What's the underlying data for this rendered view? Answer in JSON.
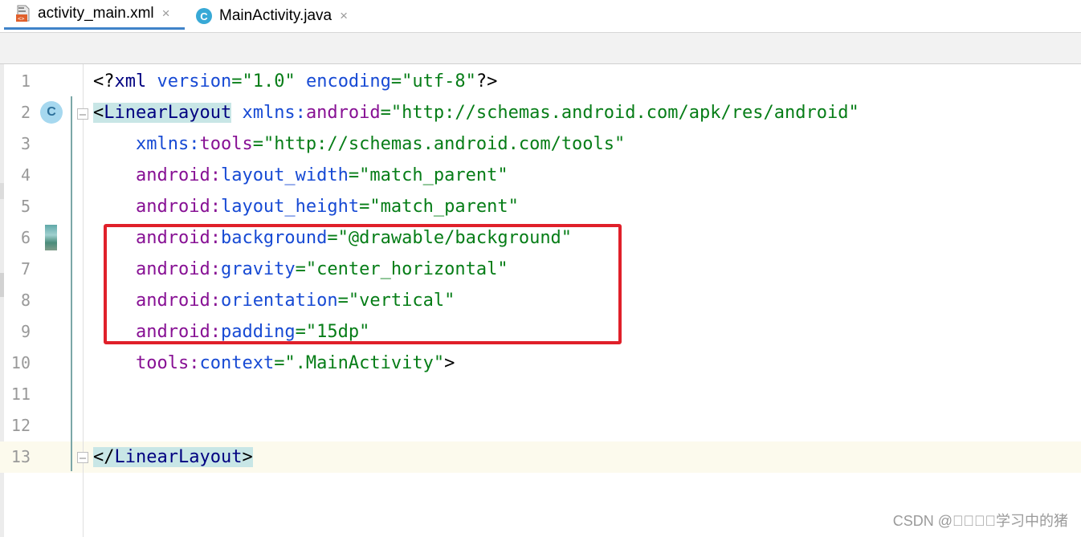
{
  "tabs": [
    {
      "label": "activity_main.xml",
      "icon": "xml-file-icon",
      "active": true
    },
    {
      "label": "MainActivity.java",
      "icon": "java-class-icon",
      "active": false
    }
  ],
  "tab_close_glyph": "×",
  "gutter": {
    "class_marker_letter": "C",
    "class_marker_icon": "class-gutter-icon",
    "drawable_preview_icon": "drawable-preview-icon"
  },
  "editor": {
    "current_line": 13,
    "lines": [
      {
        "n": "1"
      },
      {
        "n": "2"
      },
      {
        "n": "3"
      },
      {
        "n": "4"
      },
      {
        "n": "5"
      },
      {
        "n": "6"
      },
      {
        "n": "7"
      },
      {
        "n": "8"
      },
      {
        "n": "9"
      },
      {
        "n": "10"
      },
      {
        "n": "11"
      },
      {
        "n": "12"
      },
      {
        "n": "13"
      }
    ],
    "code": {
      "l1": {
        "open": "<?",
        "name": "xml",
        "sp1": " ",
        "a1": "version",
        "eq1": "=",
        "v1": "\"1.0\"",
        "sp2": " ",
        "a2": "encoding",
        "eq2": "=",
        "v2": "\"utf-8\"",
        "close": "?>"
      },
      "l2": {
        "open": "<",
        "tag": "LinearLayout",
        "sp": " ",
        "ns": "xmlns:",
        "attr": "android",
        "eq": "=",
        "val": "\"http://schemas.android.com/apk/res/android\""
      },
      "l3": {
        "indent": "    ",
        "ns": "xmlns:",
        "attr": "tools",
        "eq": "=",
        "val": "\"http://schemas.android.com/tools\""
      },
      "l4": {
        "indent": "    ",
        "ns": "android:",
        "attr": "layout_width",
        "eq": "=",
        "val": "\"match_parent\""
      },
      "l5": {
        "indent": "    ",
        "ns": "android:",
        "attr": "layout_height",
        "eq": "=",
        "val": "\"match_parent\""
      },
      "l6": {
        "indent": "    ",
        "ns": "android:",
        "attr": "background",
        "eq": "=",
        "val": "\"@drawable/background\""
      },
      "l7": {
        "indent": "    ",
        "ns": "android:",
        "attr": "gravity",
        "eq": "=",
        "val": "\"center_horizontal\""
      },
      "l8": {
        "indent": "    ",
        "ns": "android:",
        "attr": "orientation",
        "eq": "=",
        "val": "\"vertical\""
      },
      "l9": {
        "indent": "    ",
        "ns": "android:",
        "attr": "padding",
        "eq": "=",
        "val": "\"15dp\""
      },
      "l10": {
        "indent": "    ",
        "ns": "tools:",
        "attr": "context",
        "eq": "=",
        "val": "\".MainActivity\"",
        "close": ">"
      },
      "l13": {
        "open": "</",
        "tag": "LinearLayout",
        "close": ">"
      }
    }
  },
  "annotation": {
    "type": "red-rectangle",
    "lines_highlighted": [
      6,
      7,
      8,
      9
    ],
    "color": "#e0202a"
  },
  "colors": {
    "tag": "#000080",
    "attribute": "#174ad4",
    "namespace": "#871094",
    "string": "#067d17",
    "line_number": "#999999",
    "tab_underline": "#4083c9"
  },
  "watermark": "CSDN @\u0000\u0000\u0000\u0000学习中的猪"
}
